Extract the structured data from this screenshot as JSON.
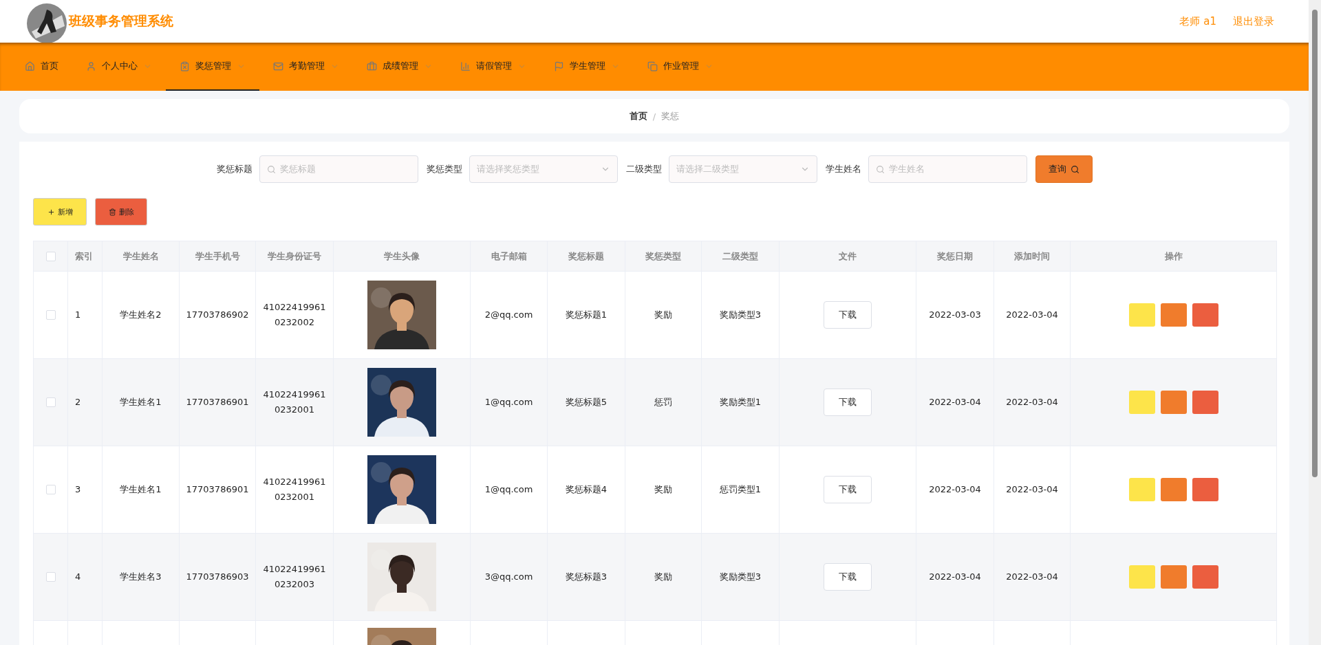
{
  "header": {
    "title": "班级事务管理系统",
    "user": "老师 a1",
    "logout": "退出登录"
  },
  "nav": [
    {
      "label": "首页",
      "dropdown": false,
      "selected": false
    },
    {
      "label": "个人中心",
      "dropdown": true,
      "selected": false
    },
    {
      "label": "奖惩管理",
      "dropdown": true,
      "selected": true
    },
    {
      "label": "考勤管理",
      "dropdown": true,
      "selected": false
    },
    {
      "label": "成绩管理",
      "dropdown": true,
      "selected": false
    },
    {
      "label": "请假管理",
      "dropdown": true,
      "selected": false
    },
    {
      "label": "学生管理",
      "dropdown": true,
      "selected": false
    },
    {
      "label": "作业管理",
      "dropdown": true,
      "selected": false
    }
  ],
  "breadcrumb": {
    "items": [
      "首页",
      "奖惩"
    ],
    "separator": "/"
  },
  "filters": [
    {
      "label": "奖惩标题",
      "kind": "search",
      "placeholder": "奖惩标题"
    },
    {
      "label": "奖惩类型",
      "kind": "select",
      "placeholder": "请选择奖惩类型"
    },
    {
      "label": "二级类型",
      "kind": "select",
      "placeholder": "请选择二级类型"
    },
    {
      "label": "学生姓名",
      "kind": "search",
      "placeholder": "学生姓名"
    }
  ],
  "query_button": "查询",
  "actions": [
    {
      "label": "新增",
      "kind": "add"
    },
    {
      "label": "删除",
      "kind": "delete"
    }
  ],
  "table": {
    "select_all": false,
    "columns": [
      "索引",
      "学生姓名",
      "学生手机号",
      "学生身份证号",
      "学生头像",
      "电子邮箱",
      "奖惩标题",
      "奖惩类型",
      "二级类型",
      "文件",
      "奖惩日期",
      "添加时间",
      "操作"
    ],
    "rows": [
      {
        "checked": false,
        "cells": [
          "1",
          "学生姓名2",
          "17703786902",
          "41022419961\n0232002",
          "",
          "2@qq.com",
          "奖惩标题1",
          "奖励",
          "奖励类型3",
          "下载",
          "2022-03-03",
          "2022-03-04"
        ]
      },
      {
        "checked": false,
        "cells": [
          "2",
          "学生姓名1",
          "17703786901",
          "41022419961\n0232001",
          "",
          "1@qq.com",
          "奖惩标题5",
          "惩罚",
          "奖励类型1",
          "下载",
          "2022-03-04",
          "2022-03-04"
        ]
      },
      {
        "checked": false,
        "cells": [
          "3",
          "学生姓名1",
          "17703786901",
          "41022419961\n0232001",
          "",
          "1@qq.com",
          "奖惩标题4",
          "奖励",
          "惩罚类型1",
          "下载",
          "2022-03-04",
          "2022-03-04"
        ]
      },
      {
        "checked": false,
        "cells": [
          "4",
          "学生姓名3",
          "17703786903",
          "41022419961\n0232003",
          "",
          "3@qq.com",
          "奖惩标题3",
          "奖励",
          "奖励类型3",
          "下载",
          "2022-03-04",
          "2022-03-04"
        ]
      }
    ]
  }
}
